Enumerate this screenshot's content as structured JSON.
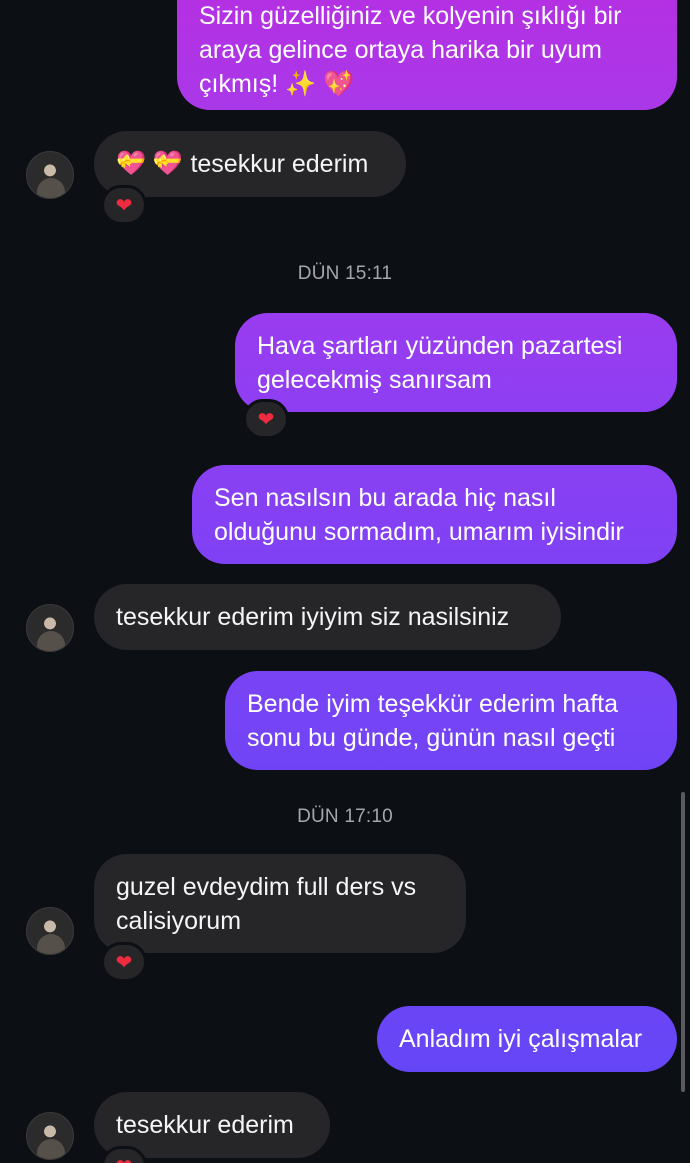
{
  "messages": {
    "m1": {
      "text": "Sizin güzelliğiniz ve kolyenin şıklığı bir araya gelince ortaya harika bir uyum çıkmış! ✨ 💖"
    },
    "m2": {
      "emoji": "💝 💝",
      "text": "tesekkur ederim",
      "reaction": "❤"
    },
    "m3": {
      "text": "Hava şartları yüzünden pazartesi gelecekmiş sanırsam",
      "reaction": "❤"
    },
    "m4": {
      "text": "Sen nasılsın bu arada hiç nasıl olduğunu sormadım, umarım iyisindir"
    },
    "m5": {
      "text": "tesekkur ederim iyiyim siz nasilsiniz"
    },
    "m6": {
      "text": "Bende iyim teşekkür ederim hafta sonu bu günde, günün nasıl geçti"
    },
    "m7": {
      "text": "guzel evdeydim full ders vs calisiyorum",
      "reaction": "❤"
    },
    "m8": {
      "text": "Anladım iyi çalışmalar"
    },
    "m9": {
      "text": "tesekkur ederim",
      "reaction": "❤"
    }
  },
  "timestamps": {
    "t1": "DÜN 15:11",
    "t2": "DÜN 17:10"
  },
  "icons": {
    "avatar": "profile-photo",
    "reaction": "red-heart-icon"
  },
  "colors": {
    "background": "#0c0f14",
    "incoming_bubble": "#262629",
    "outgoing_gradient_top": "#b233e8",
    "outgoing_gradient_bottom": "#6b3cf5",
    "heart": "#ef2b3f"
  }
}
